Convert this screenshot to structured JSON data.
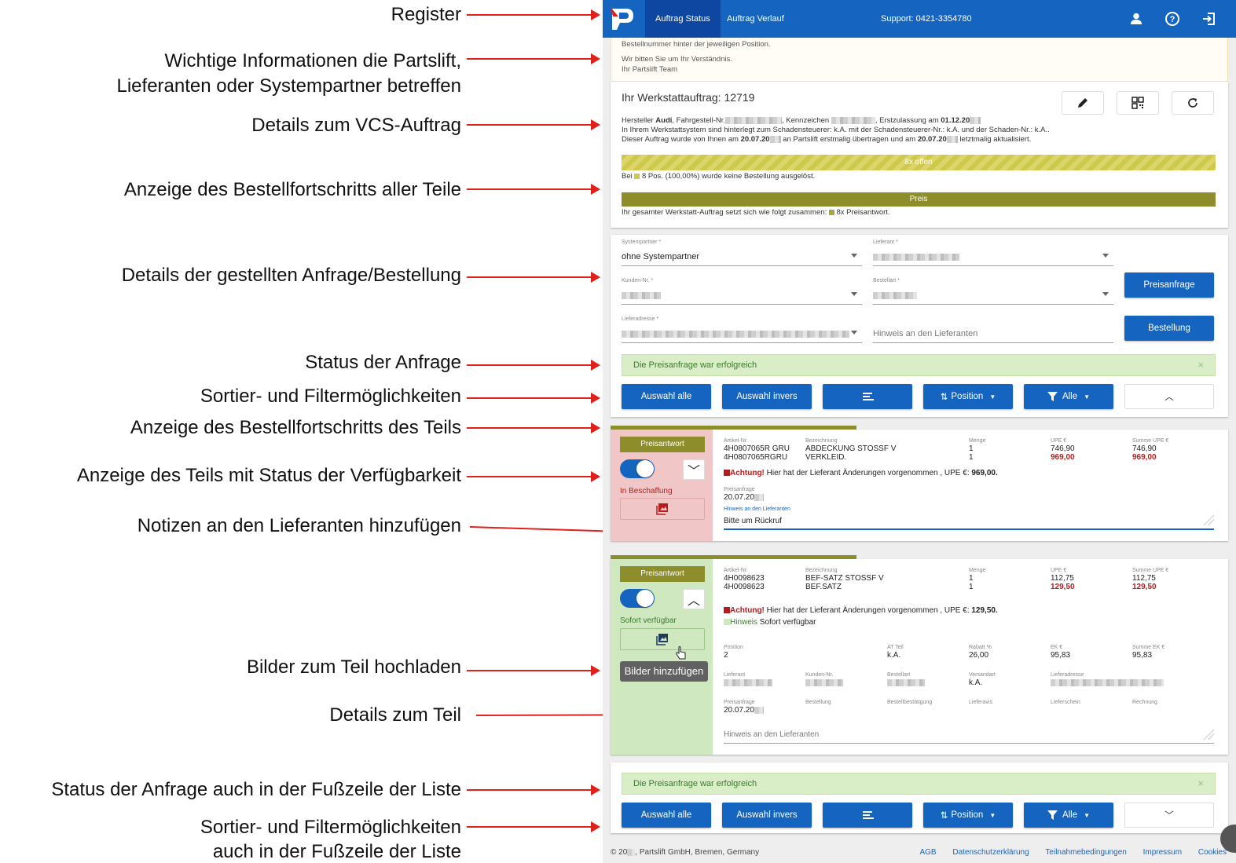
{
  "annotations": [
    {
      "text": "Register"
    },
    {
      "text": "Wichtige Informationen die Partslift,"
    },
    {
      "text": "Lieferanten oder Systempartner betreffen"
    },
    {
      "text": "Details zum VCS-Auftrag"
    },
    {
      "text": "Anzeige des Bestellfortschritts aller Teile"
    },
    {
      "text": "Details der gestellten Anfrage/Bestellung"
    },
    {
      "text": "Status der Anfrage"
    },
    {
      "text": "Sortier- und Filtermöglichkeiten"
    },
    {
      "text": "Anzeige des Bestellfortschritts des Teils"
    },
    {
      "text": "Anzeige des Teils mit Status der Verfügbarkeit"
    },
    {
      "text": "Notizen an den Lieferanten hinzufügen"
    },
    {
      "text": "Bilder zum Teil hochladen"
    },
    {
      "text": "Details zum Teil"
    },
    {
      "text": "Status der Anfrage auch in der Fußzeile der Liste"
    },
    {
      "text": "Sortier- und Filtermöglichkeiten"
    },
    {
      "text": "auch in der Fußzeile der Liste"
    }
  ],
  "colors": {
    "accent": "#1565c0",
    "arrow": "#e0211b",
    "olive": "#8d8d2b",
    "success_bg": "#d9edc7"
  },
  "header": {
    "tabs": [
      "Auftrag Status",
      "Auftrag Verlauf"
    ],
    "support": "Support: 0421-3354780",
    "icons": [
      "user-icon",
      "help-icon",
      "logout-icon"
    ]
  },
  "notice": {
    "line1": "Bestellnummer hinter der jeweiligen Position.",
    "line2": "Wir bitten Sie um Ihr Verständnis.",
    "line3": "Ihr Partslift Team"
  },
  "order": {
    "title": "Ihr Werkstattauftrag: 12719",
    "line1_a": "Hersteller ",
    "line1_brand": "Audi",
    "line1_b": ", Fahrgestell-Nr.",
    "line1_c": ", Kennzeichen",
    "line1_d": ", Erstzulassung am ",
    "line1_date": "01.12.20",
    "line2": "In Ihrem Werkstattsystem sind hinterlegt zum Schadensteuerer: k.A. mit der Schadensteuerer-Nr.: k.A. und der Schaden-Nr.: k.A..",
    "line3_a": "Dieser Auftrag wurde von Ihnen am ",
    "line3_d1": "20.07.20",
    "line3_b": " an Partslift erstmalig übertragen und am ",
    "line3_d2": "20.07.20",
    "line3_c": " letztmalig aktualisiert.",
    "progress_label": "8x offen",
    "progress_note_a": "Bei ",
    "progress_note_b": " 8 Pos. (100,00%) wurde keine Bestellung ausgelöst.",
    "price_label": "Preis",
    "price_note_a": "Ihr gesamter Werkstatt-Auftrag setzt sich wie folgt zusammen: ",
    "price_note_b": " 8x Preisantwort."
  },
  "form": {
    "systempartner_label": "Systempartner *",
    "systempartner_value": "ohne Systempartner",
    "lieferant_label": "Lieferant *",
    "kunden_label": "Kunden-Nr. *",
    "bestellart_label": "Bestellart *",
    "lieferadresse_label": "Lieferadresse *",
    "hinweis_placeholder": "Hinweis an den Lieferanten",
    "btn_preisanfrage": "Preisanfrage",
    "btn_bestellung": "Bestellung"
  },
  "alert": {
    "text": "Die Preisanfrage war erfolgreich",
    "close": "×"
  },
  "toolbar": {
    "select_all": "Auswahl alle",
    "select_invert": "Auswahl invers",
    "position": "Position",
    "filter": "Alle"
  },
  "part1": {
    "badge": "Preisantwort",
    "status": "In Beschaffung",
    "progress": 0.4,
    "h_artikel": "Artikel-Nr.",
    "artikel1": "4H0807065R GRU",
    "artikel2": "4H0807065RGRU",
    "h_bez": "Bezeichnung",
    "bez1": "ABDECKUNG STOSSF V",
    "bez2": "VERKLEID.",
    "h_menge": "Menge",
    "menge1": "1",
    "menge2": "1",
    "h_upe": "UPE €",
    "upe1": "746,90",
    "upe2": "969,00",
    "h_sum": "Summe UPE €",
    "sum1": "746,90",
    "sum2": "969,00",
    "warn_a": "Achtung!",
    "warn_b": " Hier hat der Lieferant Änderungen vorgenommen , UPE €: ",
    "warn_c": "969,00.",
    "h_preisanfrage": "Preisanfrage",
    "preisanfrage": "20.07.20",
    "h_hinweis": "Hinweis an den Lieferanten",
    "hinweis": "Bitte um Rückruf"
  },
  "part2": {
    "badge": "Preisantwort",
    "status": "Sofort verfügbar",
    "progress": 0.4,
    "h_artikel": "Artikel-Nr.",
    "artikel1": "4H0098623",
    "artikel2": "4H0098623",
    "h_bez": "Bezeichnung",
    "bez1": "BEF-SATZ STOSSF V",
    "bez2": "BEF.SATZ",
    "h_menge": "Menge",
    "menge1": "1",
    "menge2": "1",
    "h_upe": "UPE €",
    "upe1": "112,75",
    "upe2": "129,50",
    "h_sum": "Summe UPE €",
    "sum1": "112,75",
    "sum2": "129,50",
    "warn_a": "Achtung!",
    "warn_b": " Hier hat der Lieferant Änderungen vorgenommen , UPE €: ",
    "warn_c": "129,50.",
    "hint_a": "Hinweis",
    "hint_b": " Sofort verfügbar",
    "h_position": "Position",
    "position": "2",
    "h_at": "AT Teil",
    "at": "k.A.",
    "h_rabatt": "Rabatt %",
    "rabatt": "26,00",
    "h_ek": "EK €",
    "ek": "95,83",
    "h_sumek": "Summe EK €",
    "sumek": "95,83",
    "h_lieferant": "Lieferant",
    "h_kunden": "Kunden-Nr.",
    "h_bestellart": "Bestellart",
    "h_versandart": "Versandart",
    "versandart": "k.A.",
    "h_lieferadresse": "Lieferadresse",
    "h_preisanfrage": "Preisanfrage",
    "preisanfrage": "20.07.20",
    "h_bestellung": "Bestellung",
    "h_bestaet": "Bestellbestätigung",
    "h_avis": "Lieferavis",
    "h_schein": "Lieferschein",
    "h_rechnung": "Rechnung",
    "hinweis_placeholder": "Hinweis an den Lieferanten",
    "tooltip": "Bilder hinzufügen"
  },
  "footer": {
    "copyright": "© 20",
    "company": ", Partslift GmbH, Bremen, Germany",
    "links": [
      "AGB",
      "Datenschutzerklärung",
      "Teilnahmebedingungen",
      "Impressum",
      "Cookies"
    ]
  }
}
